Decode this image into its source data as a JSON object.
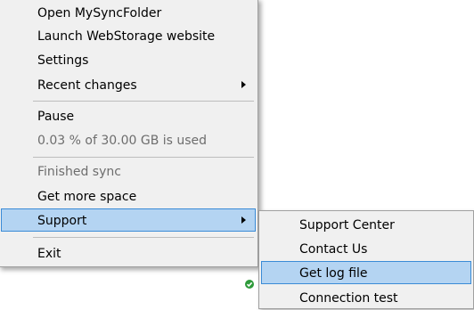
{
  "main_menu": {
    "items": [
      {
        "label": "Open MySyncFolder"
      },
      {
        "label": "Launch WebStorage website"
      },
      {
        "label": "Settings"
      },
      {
        "label": "Recent changes"
      },
      {
        "label": "Pause"
      },
      {
        "label": "0.03 % of 30.00 GB is used"
      },
      {
        "label": "Finished sync"
      },
      {
        "label": "Get more space"
      },
      {
        "label": "Support"
      },
      {
        "label": "Exit"
      }
    ]
  },
  "sub_menu": {
    "items": [
      {
        "label": "Support Center"
      },
      {
        "label": "Contact Us"
      },
      {
        "label": "Get log file"
      },
      {
        "label": "Connection test"
      }
    ]
  },
  "colors": {
    "highlight_bg": "#b4d4f2",
    "highlight_border": "#3a8bd6",
    "menu_bg": "#f0f0f0",
    "disabled_text": "#6d6d6d",
    "tray_status_green": "#2e9a3a"
  },
  "icons": {
    "submenu_arrow": "chevron-right-icon",
    "tray_status": "sync-ok-icon"
  }
}
